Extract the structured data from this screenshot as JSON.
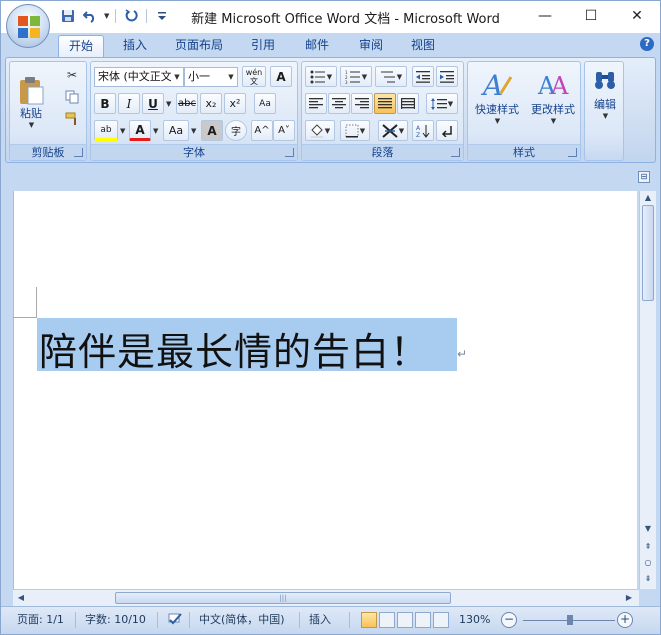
{
  "window": {
    "title": "新建 Microsoft Office Word 文档 - Microsoft Word",
    "controls": {
      "minimize": "—",
      "maximize": "☐",
      "close": "✕"
    }
  },
  "qat": {
    "save_icon": "save-icon",
    "undo_icon": "undo-icon",
    "redo_icon": "redo-icon",
    "customize_icon": "customize-qat-icon"
  },
  "tabs": [
    {
      "label": "开始",
      "active": true
    },
    {
      "label": "插入"
    },
    {
      "label": "页面布局"
    },
    {
      "label": "引用"
    },
    {
      "label": "邮件"
    },
    {
      "label": "审阅"
    },
    {
      "label": "视图"
    }
  ],
  "ribbon": {
    "clipboard": {
      "label": "剪贴板",
      "paste": "粘贴"
    },
    "font": {
      "label": "字体",
      "font_name": "宋体 (中文正文)",
      "font_size": "小一",
      "bold": "B",
      "italic": "I",
      "underline": "U",
      "strike": "abc",
      "subscript": "x₂",
      "superscript": "x²",
      "phonetic": "wén 文",
      "char_border": "A",
      "highlight": "ab",
      "font_color": "A",
      "case": "Aa",
      "shading": "A",
      "enclose": "字",
      "grow": "A^",
      "shrink": "A˅",
      "clear": "Aa"
    },
    "paragraph": {
      "label": "段落"
    },
    "styles": {
      "label": "样式",
      "quick_styles": "快速样式",
      "change_styles": "更改样式"
    },
    "editing": {
      "label": "编辑"
    }
  },
  "document": {
    "text": "陪伴是最长情的告白！",
    "paragraph_mark": "↵"
  },
  "statusbar": {
    "page": "页面: 1/1",
    "words": "字数: 10/10",
    "language": "中文(简体，中国)",
    "mode": "插入",
    "zoom": "130%",
    "zoom_out": "−",
    "zoom_in": "+"
  },
  "colors": {
    "accent": "#c4d8f1",
    "selection": "#a8cbf0",
    "title_text": "#1b1b1b",
    "label_text": "#15428b",
    "active_button": "#f8c15a"
  }
}
